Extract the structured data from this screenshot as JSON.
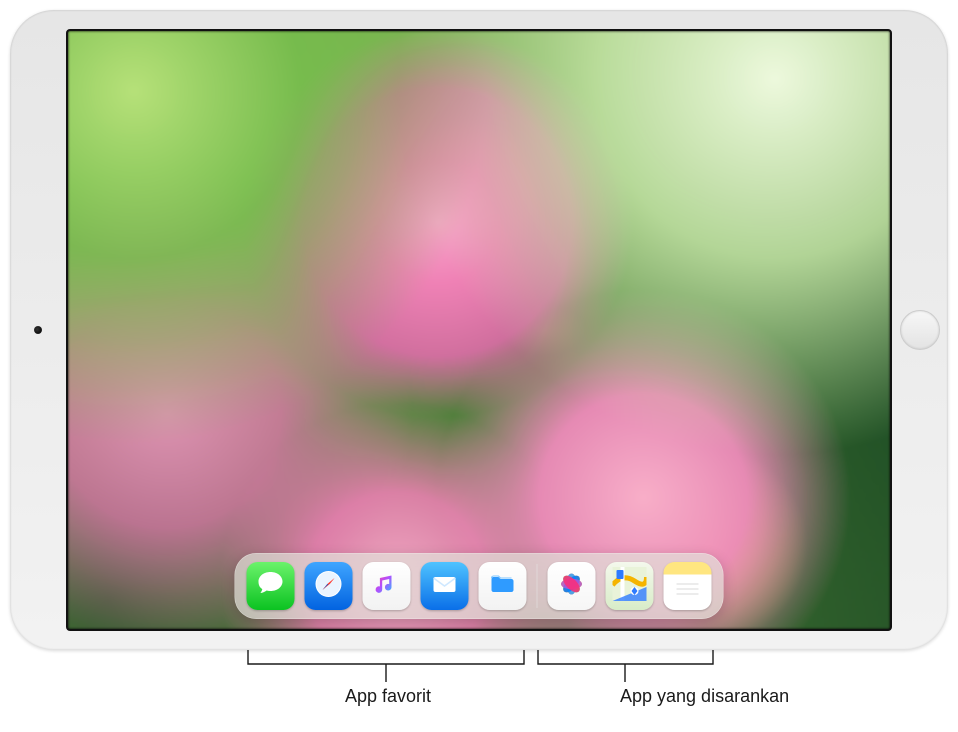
{
  "device": {
    "type": "iPad",
    "orientation": "landscape"
  },
  "dock": {
    "favorites": [
      {
        "name": "messages",
        "label": "Messages"
      },
      {
        "name": "safari",
        "label": "Safari"
      },
      {
        "name": "music",
        "label": "Music"
      },
      {
        "name": "mail",
        "label": "Mail"
      },
      {
        "name": "files",
        "label": "Files"
      }
    ],
    "suggested": [
      {
        "name": "photos",
        "label": "Photos"
      },
      {
        "name": "maps",
        "label": "Maps"
      },
      {
        "name": "notes",
        "label": "Notes"
      }
    ]
  },
  "callouts": {
    "favorites": "App favorit",
    "suggested": "App yang disarankan"
  }
}
